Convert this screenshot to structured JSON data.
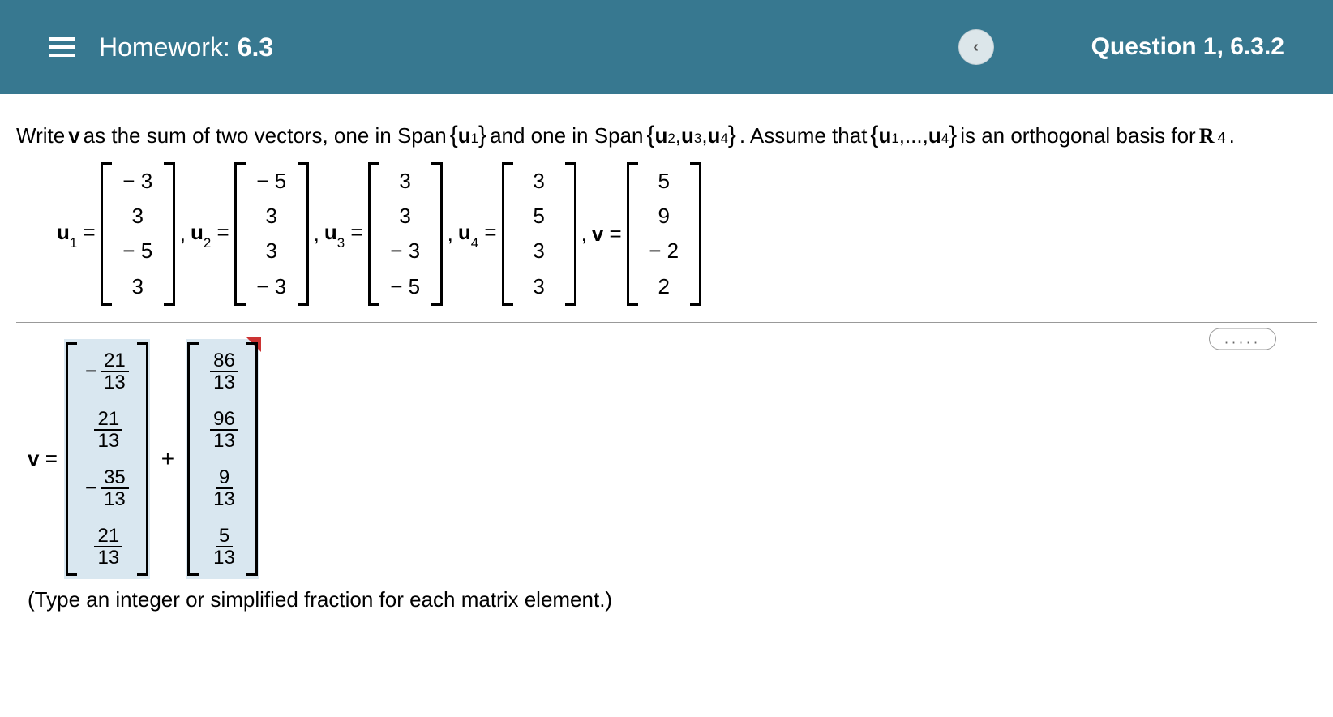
{
  "header": {
    "title_prefix": "Homework: ",
    "title_number": "6.3",
    "question_label": "Question 1, 6.3.2"
  },
  "prompt": {
    "p1": "Write ",
    "v": "v",
    "p2": " as the sum of two vectors, one in Span ",
    "set1_items": [
      "u",
      "1"
    ],
    "p3": " and one in Span ",
    "set2": "u₂,u₃,u₄",
    "p4": ". Assume that ",
    "set3": "u₁,...,u₄",
    "p5": " is an orthogonal basis for ",
    "R": "R",
    "exp": "4",
    "p6": "."
  },
  "vectors": {
    "labels": {
      "u1": "u",
      "u1s": "1",
      "eq": " = ",
      "u2": "u",
      "u2s": "2",
      "u3": "u",
      "u3s": "3",
      "u4": "u",
      "u4s": "4",
      "v": "v"
    },
    "u1": [
      "− 3",
      "3",
      "− 5",
      "3"
    ],
    "u2": [
      "− 5",
      "3",
      "3",
      "− 3"
    ],
    "u3": [
      "3",
      "3",
      "− 3",
      "− 5"
    ],
    "u4": [
      "3",
      "5",
      "3",
      "3"
    ],
    "v": [
      "5",
      "9",
      "− 2",
      "2"
    ],
    "comma": ", "
  },
  "answer": {
    "lhs": "v = ",
    "plus": "+",
    "col1": [
      {
        "neg": "−",
        "num": "21",
        "den": "13"
      },
      {
        "neg": "",
        "num": "21",
        "den": "13"
      },
      {
        "neg": "−",
        "num": "35",
        "den": "13"
      },
      {
        "neg": "",
        "num": "21",
        "den": "13"
      }
    ],
    "col2": [
      {
        "neg": "",
        "num": "86",
        "den": "13"
      },
      {
        "neg": "",
        "num": "96",
        "den": "13"
      },
      {
        "neg": "",
        "num": "9",
        "den": "13"
      },
      {
        "neg": "",
        "num": "5",
        "den": "13"
      }
    ]
  },
  "hint": "(Type an integer or simplified fraction for each matrix element.)",
  "dots": "....."
}
